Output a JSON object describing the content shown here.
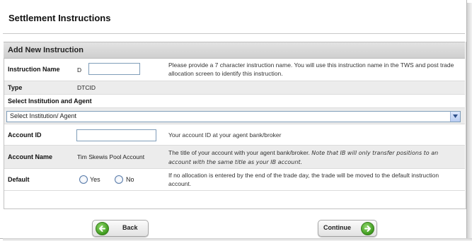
{
  "page": {
    "title": "Settlement Instructions"
  },
  "section": {
    "title": "Add New Instruction"
  },
  "rows": {
    "instruction_name": {
      "label": "Instruction Name",
      "prefix": "D",
      "value": "",
      "help": "Please provide a 7 character instruction name. You will use this instruction name in the TWS and post trade allocation screen to identify this instruction."
    },
    "type": {
      "label": "Type",
      "value": "DTCID"
    },
    "institution": {
      "label": "Select Institution and Agent",
      "selected": "Select Institution/ Agent"
    },
    "account_id": {
      "label": "Account ID",
      "value": "",
      "help": "Your account ID at your agent bank/broker"
    },
    "account_name": {
      "label": "Account Name",
      "value": "Tim Skewis Pool Account",
      "help_plain": "The title of your account with your agent bank/broker.",
      "help_italic": "Note that IB will only transfer positions to an account with the same title as your IB account."
    },
    "default": {
      "label": "Default",
      "options": [
        "Yes",
        "No"
      ],
      "help": "If no allocation is entered by the end of the trade day, the trade will be moved to the default instruction account."
    }
  },
  "buttons": {
    "back": "Back",
    "continue": "Continue"
  },
  "icons": {
    "back": "arrow-left-icon",
    "continue": "arrow-right-icon",
    "select": "chevron-down-icon"
  },
  "colors": {
    "header_bg": "#d8d8d8",
    "row_grey": "#ececec",
    "button_green": "#3f9b1e",
    "input_border": "#7f9db9"
  }
}
